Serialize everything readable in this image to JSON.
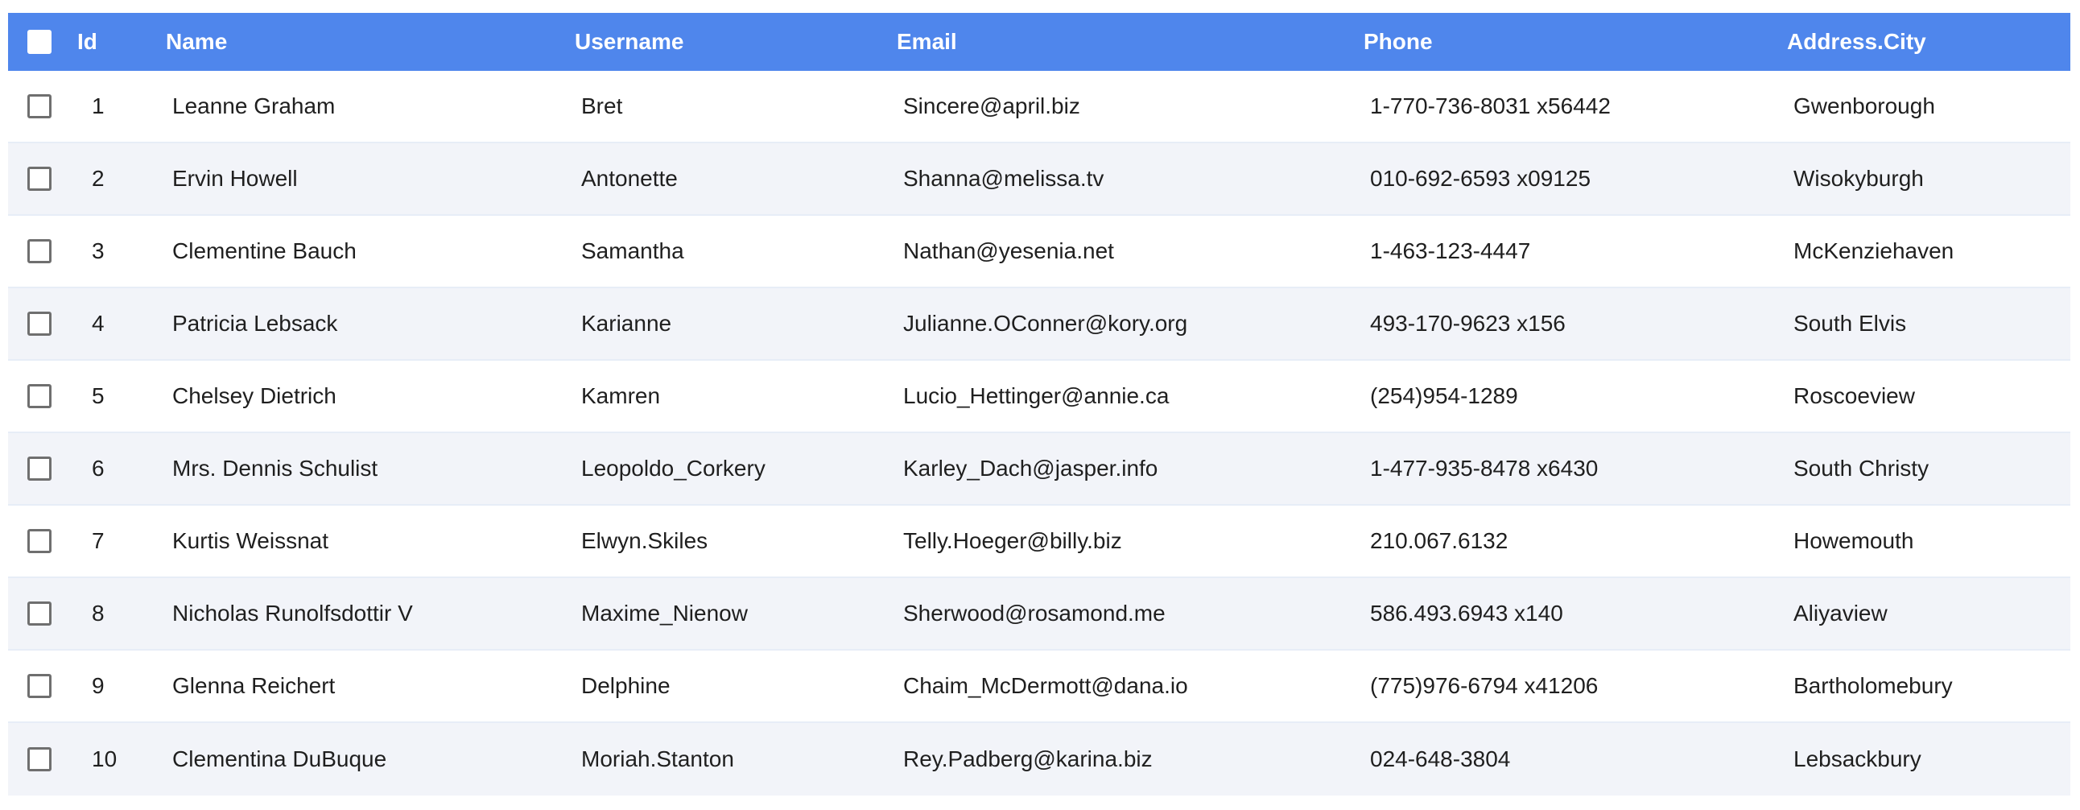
{
  "table": {
    "columns": {
      "id": "Id",
      "name": "Name",
      "username": "Username",
      "email": "Email",
      "phone": "Phone",
      "city": "Address.City"
    },
    "header_color": "#4f86ec",
    "rows": [
      {
        "id": "1",
        "name": "Leanne Graham",
        "username": "Bret",
        "email": "Sincere@april.biz",
        "phone": "1-770-736-8031 x56442",
        "city": "Gwenborough"
      },
      {
        "id": "2",
        "name": "Ervin Howell",
        "username": "Antonette",
        "email": "Shanna@melissa.tv",
        "phone": "010-692-6593 x09125",
        "city": "Wisokyburgh"
      },
      {
        "id": "3",
        "name": "Clementine Bauch",
        "username": "Samantha",
        "email": "Nathan@yesenia.net",
        "phone": "1-463-123-4447",
        "city": "McKenziehaven"
      },
      {
        "id": "4",
        "name": "Patricia Lebsack",
        "username": "Karianne",
        "email": "Julianne.OConner@kory.org",
        "phone": "493-170-9623 x156",
        "city": "South Elvis"
      },
      {
        "id": "5",
        "name": "Chelsey Dietrich",
        "username": "Kamren",
        "email": "Lucio_Hettinger@annie.ca",
        "phone": "(254)954-1289",
        "city": "Roscoeview"
      },
      {
        "id": "6",
        "name": "Mrs. Dennis Schulist",
        "username": "Leopoldo_Corkery",
        "email": "Karley_Dach@jasper.info",
        "phone": "1-477-935-8478 x6430",
        "city": "South Christy"
      },
      {
        "id": "7",
        "name": "Kurtis Weissnat",
        "username": "Elwyn.Skiles",
        "email": "Telly.Hoeger@billy.biz",
        "phone": "210.067.6132",
        "city": "Howemouth"
      },
      {
        "id": "8",
        "name": "Nicholas Runolfsdottir V",
        "username": "Maxime_Nienow",
        "email": "Sherwood@rosamond.me",
        "phone": "586.493.6943 x140",
        "city": "Aliyaview"
      },
      {
        "id": "9",
        "name": "Glenna Reichert",
        "username": "Delphine",
        "email": "Chaim_McDermott@dana.io",
        "phone": "(775)976-6794 x41206",
        "city": "Bartholomebury"
      },
      {
        "id": "10",
        "name": "Clementina DuBuque",
        "username": "Moriah.Stanton",
        "email": "Rey.Padberg@karina.biz",
        "phone": "024-648-3804",
        "city": "Lebsackbury"
      }
    ]
  }
}
